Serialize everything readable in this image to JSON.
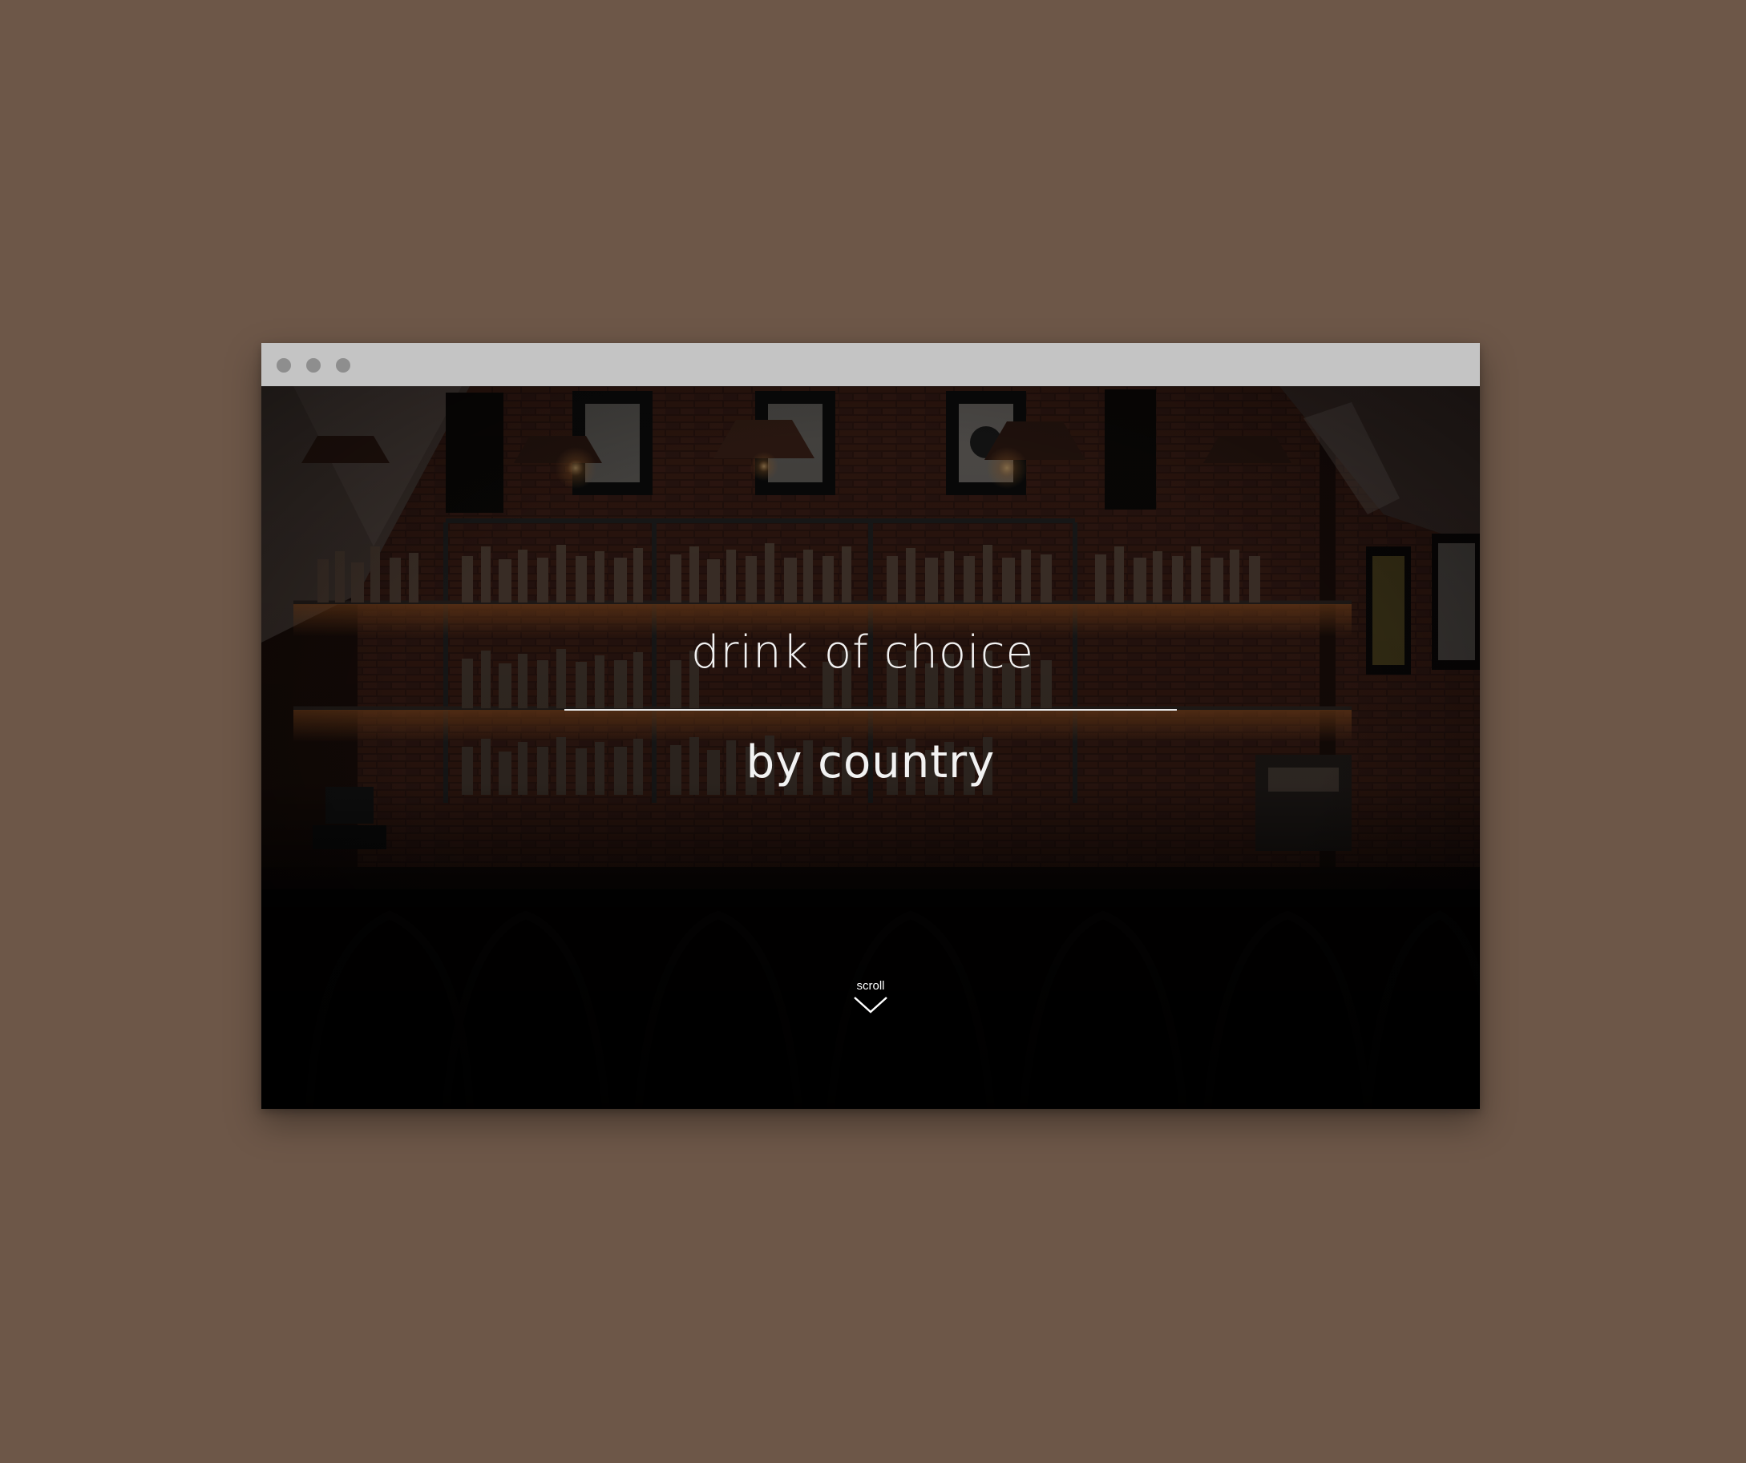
{
  "page": {
    "background": "#6d5748"
  },
  "browser": {
    "title_bar_color": "#c4c4c4",
    "window_dots": [
      "close-dot",
      "minimize-dot",
      "maximize-dot"
    ]
  },
  "hero": {
    "title_line_1": "drink of choice",
    "title_line_2": "by country",
    "scroll_label": "scroll",
    "scroll_icon": "chevron-down-icon",
    "background_image": "dimly lit bar with bottle shelves"
  }
}
